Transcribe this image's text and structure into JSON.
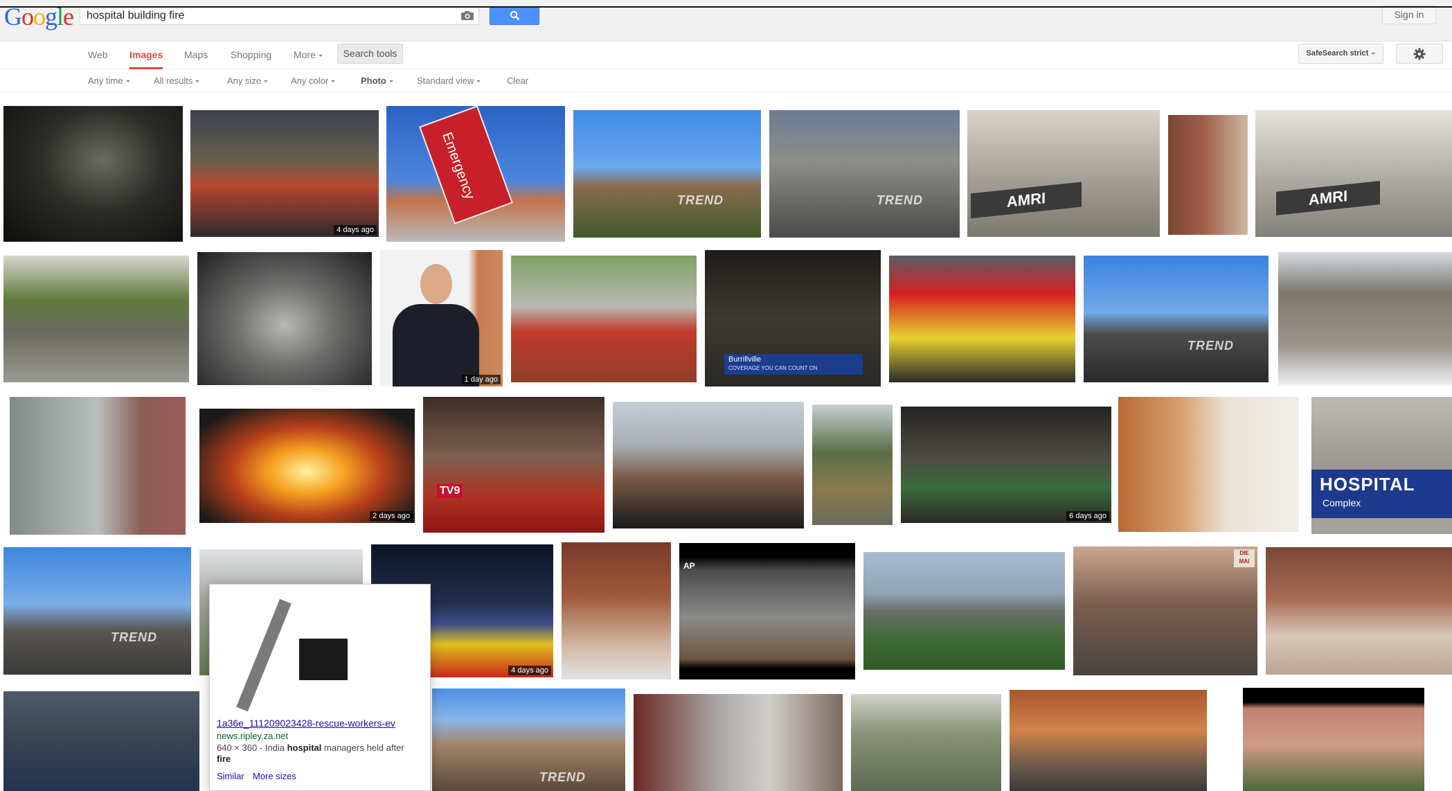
{
  "header": {
    "logo_letters": [
      "G",
      "o",
      "o",
      "g",
      "l",
      "e"
    ],
    "logo_colors": [
      "#2963e8",
      "#d93025",
      "#f2b400",
      "#2963e8",
      "#1e9e3e",
      "#d93025"
    ],
    "query": "hospital building fire",
    "camera_icon": "camera-icon",
    "search_icon": "magnifier-icon",
    "sign_in_label": "Sign in"
  },
  "nav": {
    "items": [
      {
        "label": "Web"
      },
      {
        "label": "Images",
        "active": true
      },
      {
        "label": "Maps"
      },
      {
        "label": "Shopping"
      },
      {
        "label": "More"
      }
    ],
    "search_tools_label": "Search tools",
    "safesearch_label": "SafeSearch strict",
    "gear_icon": "gear-icon"
  },
  "tools": {
    "items": [
      {
        "label": "Any time"
      },
      {
        "label": "All results"
      },
      {
        "label": "Any size"
      },
      {
        "label": "Any color"
      },
      {
        "label": "Photo",
        "bold": true
      },
      {
        "label": "Standard view"
      }
    ],
    "clear_label": "Clear"
  },
  "results": {
    "badges": [
      "4 days ago",
      "1 day ago",
      "2 days ago",
      "6 days ago",
      "4 days ago"
    ],
    "overlay_texts": [
      "Emergency",
      "AMRI",
      "AMRI",
      "TREND",
      "TREND",
      "TREND",
      "TREND",
      "TREND",
      "HOSPITAL",
      "Complex",
      "Burrillville",
      "COVERAGE YOU CAN COUNT ON",
      "TV9",
      "AP",
      "DIE MAI"
    ]
  },
  "hovercard": {
    "title": "1a36e_111209023428-rescue-workers-ev",
    "site": "news.ripley.za.net",
    "desc_prefix": "640 × 360 - India ",
    "desc_bold1": "hospital",
    "desc_mid": " managers held after ",
    "desc_bold2": "fire",
    "similar_label": "Similar",
    "more_sizes_label": "More sizes"
  }
}
